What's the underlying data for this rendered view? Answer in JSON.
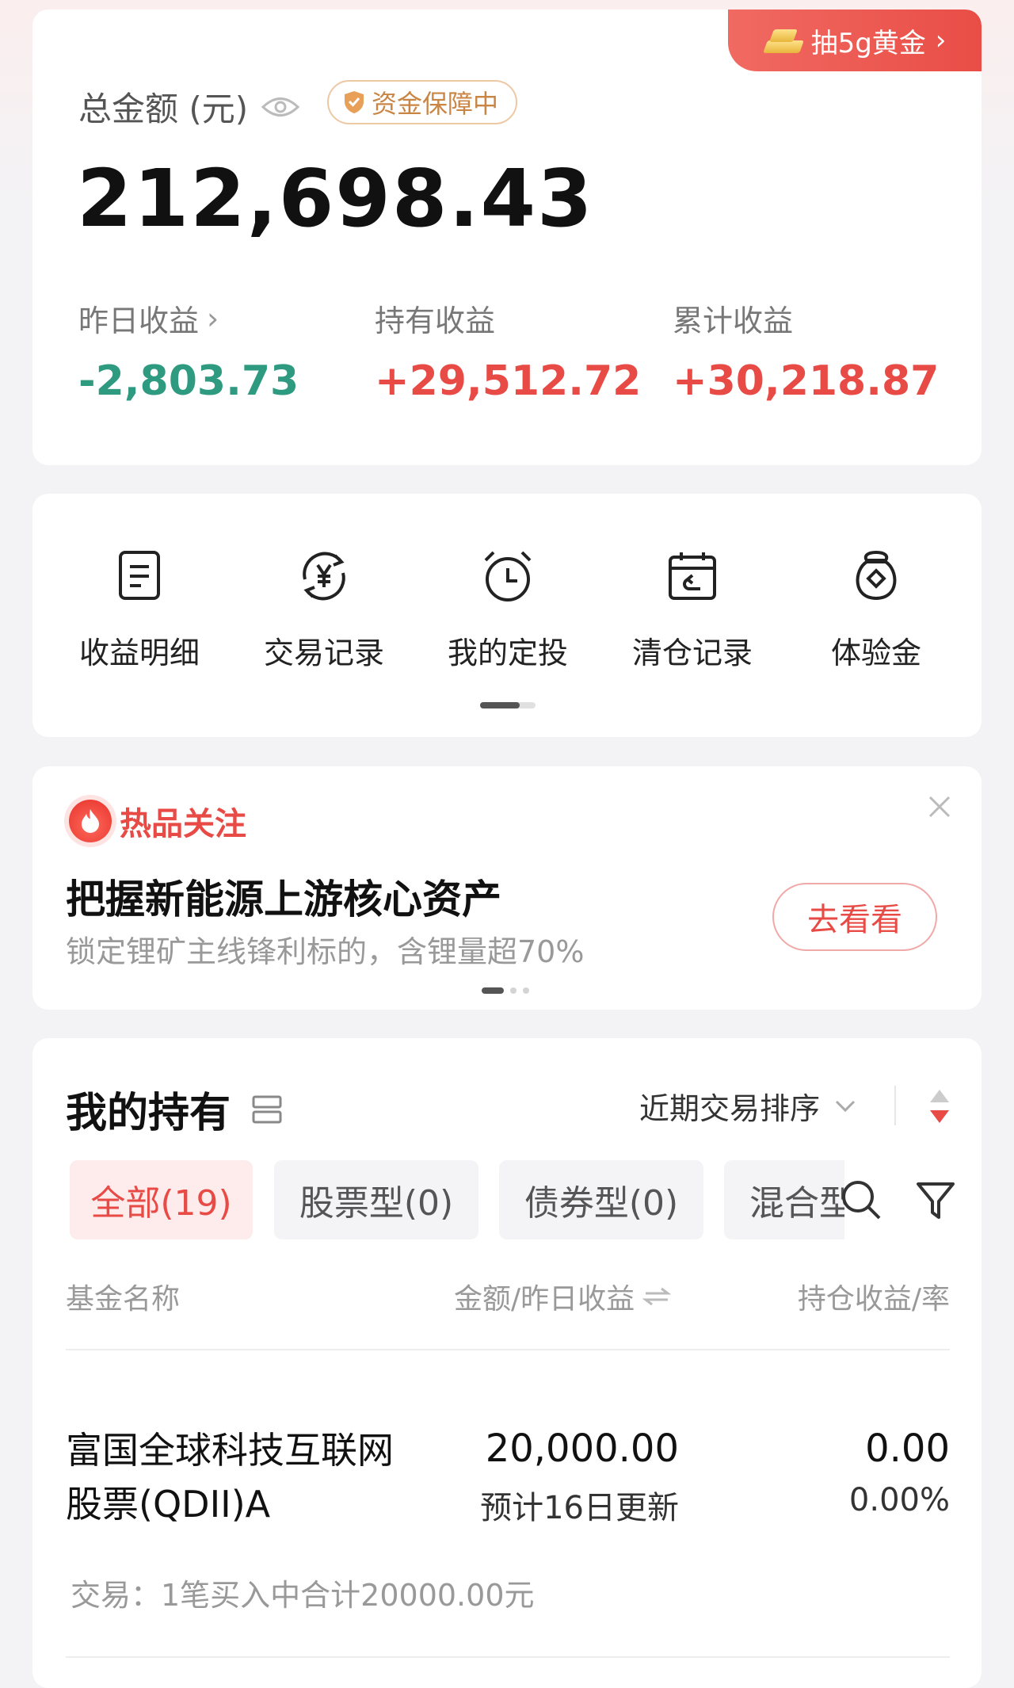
{
  "summary": {
    "gold_badge": "抽5g黄金",
    "gold_chevron": "›",
    "total_label": "总金额 (元)",
    "safe_badge": "资金保障中",
    "total_value": "212,698.43",
    "stats": [
      {
        "label": "昨日收益",
        "value": "-2,803.73",
        "has_chevron": true
      },
      {
        "label": "持有收益",
        "value": "+29,512.72"
      },
      {
        "label": "累计收益",
        "value": "+30,218.87"
      }
    ],
    "colors": {
      "negative": "#2e9a80",
      "positive": "#e84a45",
      "accent": "#e84a45"
    }
  },
  "shortcuts": {
    "items": [
      {
        "label": "收益明细",
        "icon": "document-icon"
      },
      {
        "label": "交易记录",
        "icon": "yuan-exchange-icon"
      },
      {
        "label": "我的定投",
        "icon": "alarm-clock-icon"
      },
      {
        "label": "清仓记录",
        "icon": "calendar-return-icon"
      },
      {
        "label": "体验金",
        "icon": "money-bag-icon"
      }
    ]
  },
  "promo": {
    "tag": "热品关注",
    "title": "把握新能源上游核心资产",
    "subtitle": "锁定锂矿主线锋利标的，含锂量超70%",
    "button": "去看看"
  },
  "holdings": {
    "title": "我的持有",
    "sort_label": "近期交易排序",
    "tabs": [
      "全部(19)",
      "股票型(0)",
      "债券型(0)",
      "混合型"
    ],
    "columns": {
      "name": "基金名称",
      "amount": "金额/昨日收益",
      "profit": "持仓收益/率"
    },
    "funds": [
      {
        "name_line1": "富国全球科技互联网",
        "name_line2": "股票(QDII)A",
        "amount": "20,000.00",
        "amount_sub": "预计16日更新",
        "profit": "0.00",
        "rate": "0.00%",
        "trade_note": "交易：1笔买入中合计20000.00元"
      }
    ]
  }
}
